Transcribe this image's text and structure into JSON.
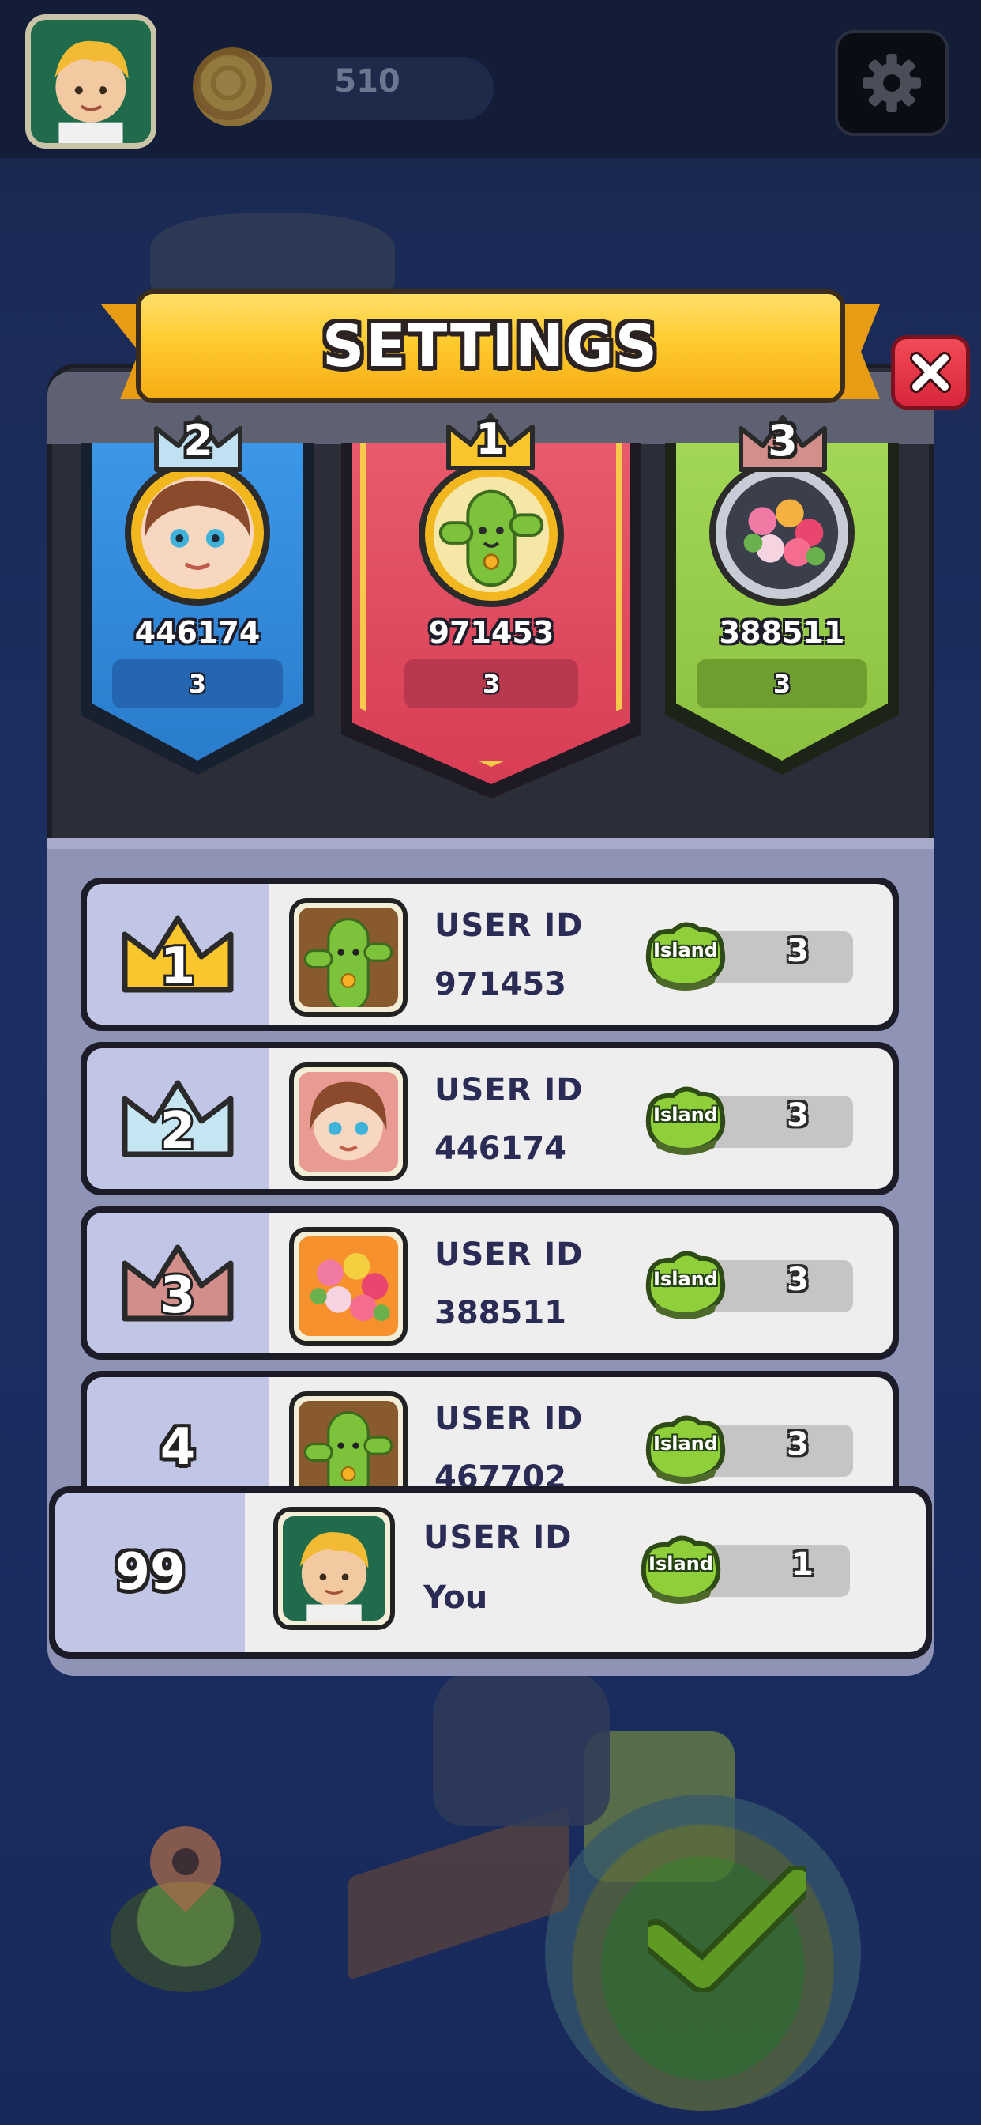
{
  "hud": {
    "coins": "510",
    "player_avatar": "blonde-boy-avatar",
    "settings_icon": "gear-icon"
  },
  "panel": {
    "title": "SETTINGS",
    "close_icon": "close-icon"
  },
  "podium": [
    {
      "rank": "2",
      "score": "446174",
      "islands": "3",
      "avatar": "girl-avatar",
      "color": "#2f86d6"
    },
    {
      "rank": "1",
      "score": "971453",
      "islands": "3",
      "avatar": "cactus-avatar",
      "color": "#e0475f"
    },
    {
      "rank": "3",
      "score": "388511",
      "islands": "3",
      "avatar": "bouquet-avatar",
      "color": "#93c947"
    }
  ],
  "leaderboard": {
    "uid_label": "USER ID",
    "island_label": "Island",
    "rows": [
      {
        "rank": "1",
        "user_id": "971453",
        "islands": "3",
        "avatar": "cactus-avatar"
      },
      {
        "rank": "2",
        "user_id": "446174",
        "islands": "3",
        "avatar": "girl-avatar"
      },
      {
        "rank": "3",
        "user_id": "388511",
        "islands": "3",
        "avatar": "bouquet-avatar"
      },
      {
        "rank": "4",
        "user_id": "467702",
        "islands": "3",
        "avatar": "cactus-avatar"
      }
    ],
    "me": {
      "rank": "99",
      "user_id": "You",
      "islands": "1",
      "avatar": "blonde-boy-avatar"
    }
  }
}
